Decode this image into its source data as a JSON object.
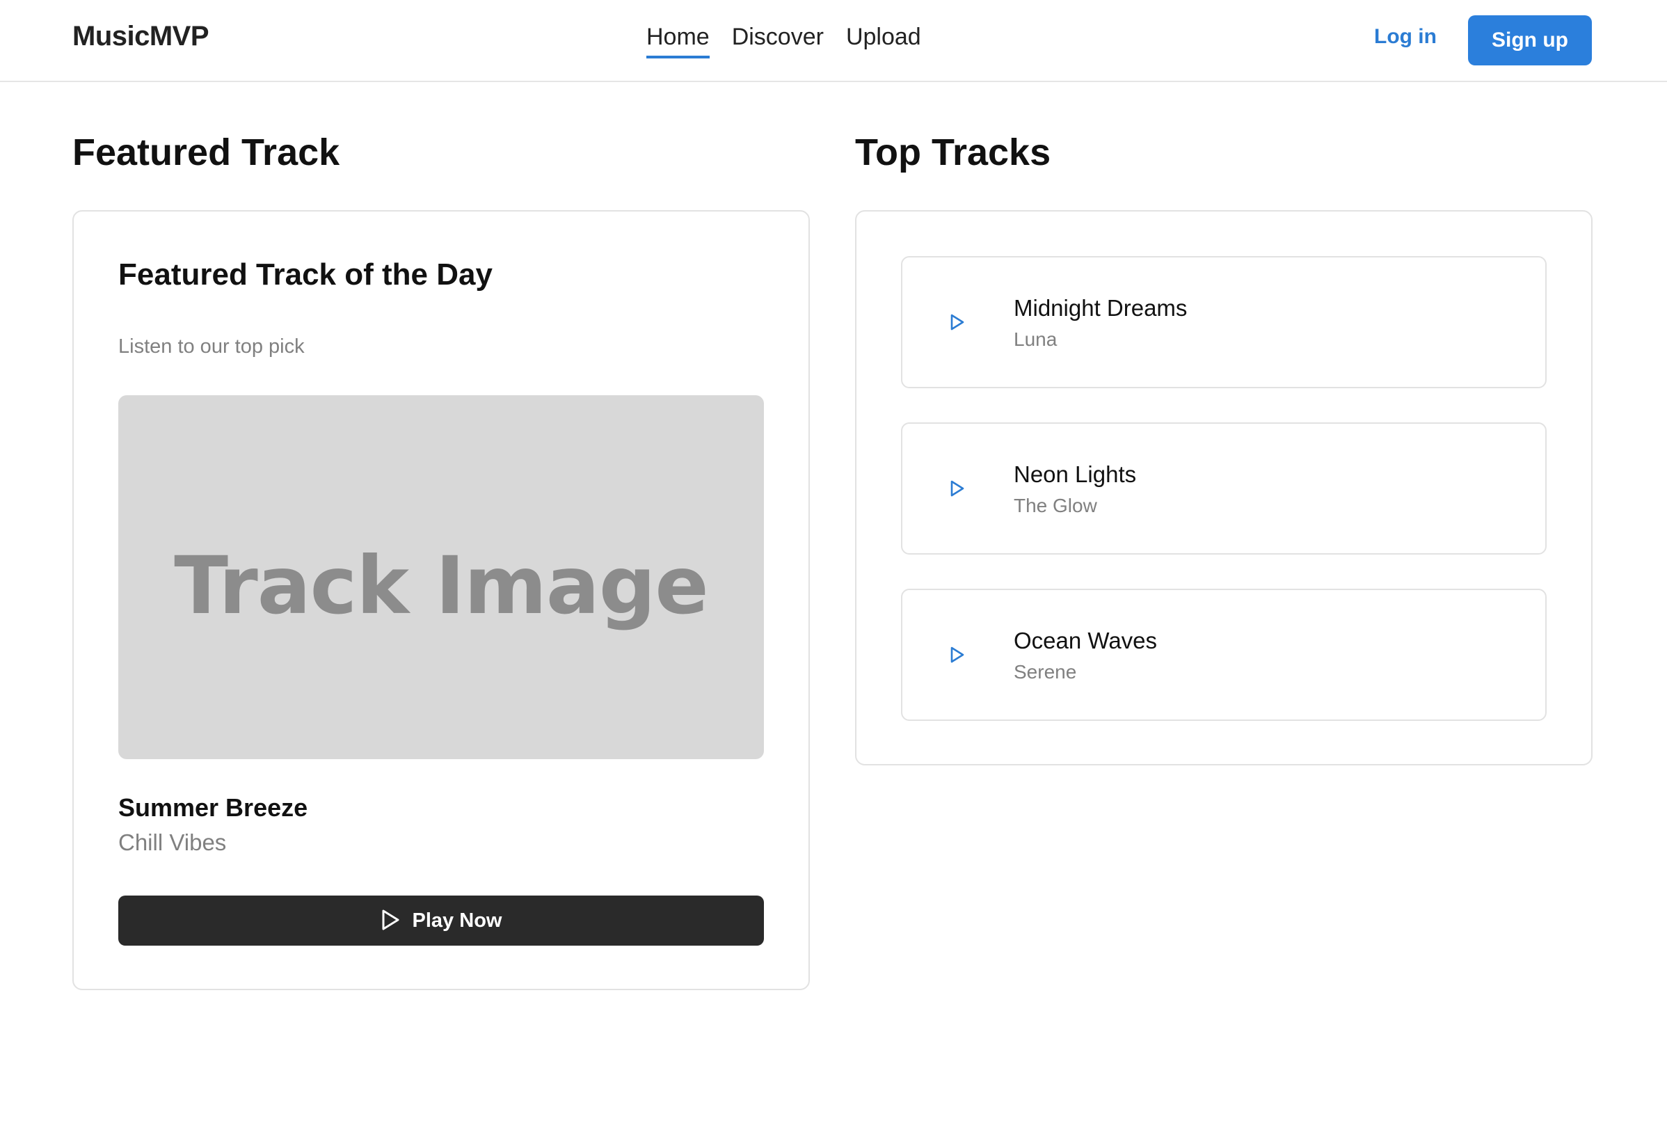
{
  "header": {
    "brand": "MusicMVP",
    "nav": [
      {
        "label": "Home",
        "active": true
      },
      {
        "label": "Discover",
        "active": false
      },
      {
        "label": "Upload",
        "active": false
      }
    ],
    "login_label": "Log in",
    "signup_label": "Sign up"
  },
  "featured": {
    "section_title": "Featured Track",
    "heading": "Featured Track of the Day",
    "subtitle": "Listen to our top pick",
    "image_placeholder": "Track Image",
    "track_title": "Summer Breeze",
    "artist": "Chill Vibes",
    "play_label": "Play Now",
    "play_icon": "play-icon"
  },
  "top_tracks": {
    "section_title": "Top Tracks",
    "items": [
      {
        "title": "Midnight Dreams",
        "artist": "Luna",
        "icon": "play-icon"
      },
      {
        "title": "Neon Lights",
        "artist": "The Glow",
        "icon": "play-icon"
      },
      {
        "title": "Ocean Waves",
        "artist": "Serene",
        "icon": "play-icon"
      }
    ]
  },
  "colors": {
    "accent": "#2b7cd3",
    "primary_button": "#2b7fdc",
    "dark_button": "#2a2a2a",
    "muted_text": "#808080",
    "placeholder_bg": "#d8d8d8"
  }
}
